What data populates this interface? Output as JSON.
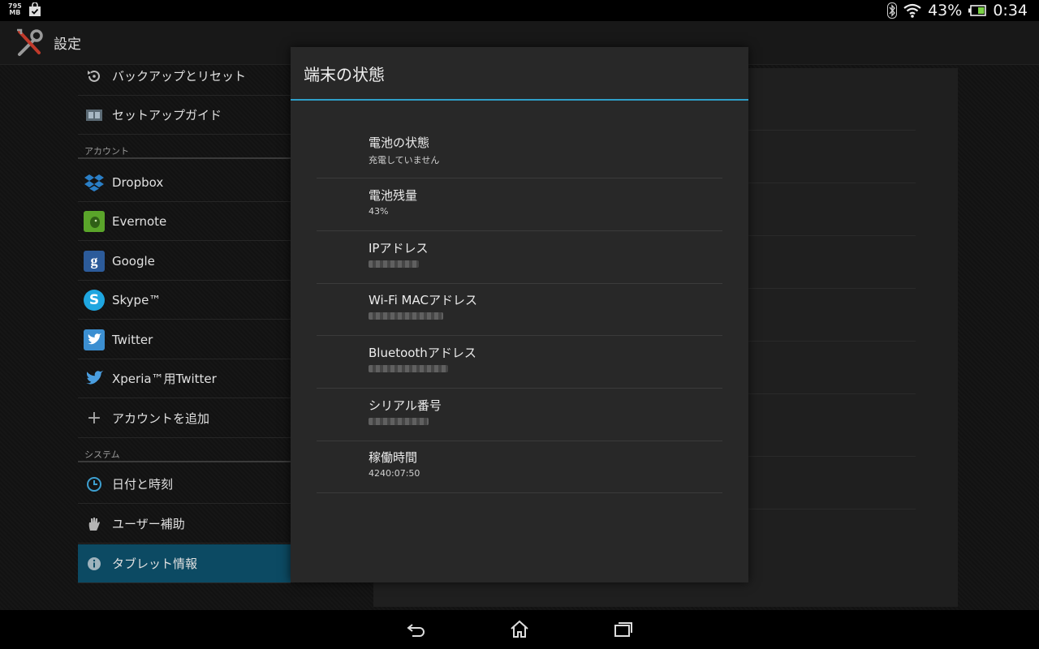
{
  "status_bar": {
    "memory_top": "795",
    "memory_unit": "MB",
    "battery_percent_text": "43%",
    "time": "0:34",
    "icons": [
      "memory-indicator",
      "bag-check-icon",
      "bluetooth-icon",
      "wifi-icon",
      "battery-icon"
    ]
  },
  "action_bar": {
    "title": "設定",
    "icon": "tools-icon"
  },
  "sidebar": {
    "items": [
      {
        "label": "バックアップとリセット",
        "icon": "restore-icon"
      },
      {
        "label": "セットアップガイド",
        "icon": "guide-icon"
      },
      {
        "label": "Dropbox",
        "icon": "dropbox-icon"
      },
      {
        "label": "Evernote",
        "icon": "evernote-icon"
      },
      {
        "label": "Google",
        "icon": "google-icon"
      },
      {
        "label": "Skype™",
        "icon": "skype-icon"
      },
      {
        "label": "Twitter",
        "icon": "twitter-icon"
      },
      {
        "label": "Xperia™用Twitter",
        "icon": "twitter-bird-icon"
      },
      {
        "label": "アカウントを追加",
        "icon": "plus-icon"
      },
      {
        "label": "日付と時刻",
        "icon": "clock-icon"
      },
      {
        "label": "ユーザー補助",
        "icon": "hand-icon"
      },
      {
        "label": "タブレット情報",
        "icon": "info-icon"
      }
    ],
    "sections": {
      "accounts": "アカウント",
      "system": "システム"
    },
    "selected_index": 11
  },
  "dialog": {
    "title": "端末の状態",
    "rows": [
      {
        "title": "電池の状態",
        "value": "充電していません"
      },
      {
        "title": "電池残量",
        "value": "43%"
      },
      {
        "title": "IPアドレス",
        "value": ""
      },
      {
        "title": "Wi-Fi MACアドレス",
        "value": ""
      },
      {
        "title": "Bluetoothアドレス",
        "value": ""
      },
      {
        "title": "シリアル番号",
        "value": ""
      },
      {
        "title": "稼働時間",
        "value": "4240:07:50"
      }
    ]
  },
  "colors": {
    "accent": "#2f9fc8",
    "selected_bg": "#0c4a63",
    "dialog_bg": "#282828"
  },
  "nav_bar": {
    "icons": [
      "back-icon",
      "home-icon",
      "recent-apps-icon"
    ]
  }
}
